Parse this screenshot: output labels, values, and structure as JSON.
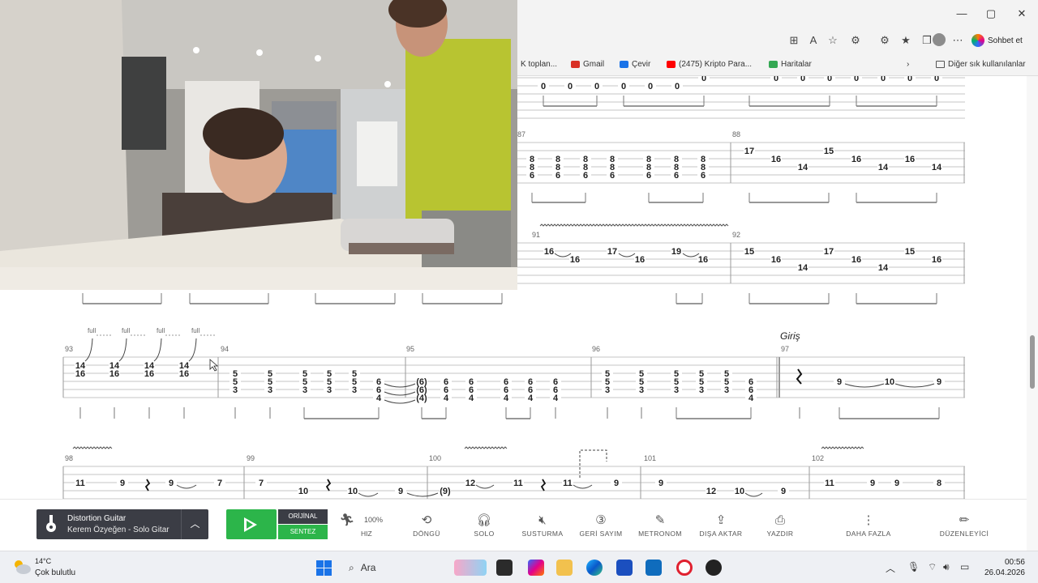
{
  "browser": {
    "window_controls": {
      "minimize": "—",
      "maximize": "▢",
      "close": "✕"
    },
    "chat_button_label": "Sohbet et",
    "bookmarks": [
      {
        "label": "K toplan...",
        "icon": "bookmark-icon",
        "color": "#9a9a9a"
      },
      {
        "label": "Gmail",
        "icon": "gmail-icon",
        "color": "#d93025"
      },
      {
        "label": "Çevir",
        "icon": "translate-icon",
        "color": "#1a73e8"
      },
      {
        "label": "(2475) Kripto Para...",
        "icon": "youtube-icon",
        "color": "#ff0000"
      },
      {
        "label": "Haritalar",
        "icon": "maps-icon",
        "color": "#34a853"
      }
    ],
    "other_bookmarks_label": "Diğer sık kullanılanlar"
  },
  "score": {
    "section_marker": "Giriş",
    "bend_label": "full",
    "measure_numbers": [
      "87",
      "88",
      "91",
      "92",
      "93",
      "94",
      "95",
      "96",
      "97",
      "98",
      "99",
      "100",
      "101",
      "102"
    ],
    "row1_notes": [
      {
        "t": "0",
        "s": 1
      },
      {
        "t": "0",
        "s": 1
      },
      {
        "t": "0",
        "s": 1
      },
      {
        "t": "0",
        "s": 1
      },
      {
        "t": "0",
        "s": 1
      },
      {
        "t": "0",
        "s": 1
      },
      {
        "t": "0",
        "s": 2
      },
      {
        "t": "0",
        "s": 2
      },
      {
        "t": "0",
        "s": 2
      },
      {
        "t": "0",
        "s": 2
      },
      {
        "t": "0",
        "s": 2
      },
      {
        "t": "0",
        "s": 2
      },
      {
        "t": "0",
        "s": 2
      },
      {
        "t": "0",
        "s": 2
      }
    ],
    "m87_chord": [
      "8",
      "8",
      "6"
    ],
    "m88_notes": [
      "17",
      "16",
      "14",
      "15",
      "16",
      "14",
      "16",
      "14"
    ],
    "m91_notes": [
      "16",
      "16",
      "17",
      "16",
      "19",
      "16"
    ],
    "m92_notes": [
      "15",
      "16",
      "14",
      "17",
      "16",
      "14",
      "15",
      "16"
    ],
    "m93_notes": [
      "14",
      "16"
    ],
    "m94_chord": [
      "5",
      "5",
      "3"
    ],
    "m95_chord": [
      "6",
      "6",
      "4"
    ],
    "m95_tied": [
      "(6)",
      "(6)",
      "(4)"
    ],
    "m97_notes": [
      "9",
      "10",
      "9"
    ],
    "m98_notes": [
      "11",
      "9",
      "9",
      "7"
    ],
    "m99_notes": [
      "7",
      "10",
      "10",
      "9",
      "(9)"
    ],
    "m100_notes": [
      "12",
      "11",
      "11",
      "9"
    ],
    "m101_notes": [
      "9",
      "12",
      "10",
      "9"
    ],
    "m102_notes": [
      "11",
      "9",
      "9",
      "8"
    ]
  },
  "toolbar": {
    "instrument_name": "Distortion Guitar",
    "instrument_track": "Kerem Özyeğen - Solo Gitar",
    "mode_original": "ORİJİNAL",
    "mode_synth": "SENTEZ",
    "speed_value": "100%",
    "items": [
      {
        "label": "HIZ",
        "icon": "speed-icon"
      },
      {
        "label": "DÖNGÜ",
        "icon": "loop-icon"
      },
      {
        "label": "SOLO",
        "icon": "headphones-icon"
      },
      {
        "label": "SUSTURMA",
        "icon": "mute-icon"
      },
      {
        "label": "GERİ SAYIM",
        "icon": "countdown-icon"
      },
      {
        "label": "METRONOM",
        "icon": "metronome-icon"
      },
      {
        "label": "DIŞA AKTAR",
        "icon": "export-icon"
      },
      {
        "label": "YAZDIR",
        "icon": "print-icon"
      },
      {
        "label": "DAHA FAZLA",
        "icon": "more-icon"
      },
      {
        "label": "DÜZENLEYİCİ",
        "icon": "editor-icon"
      }
    ]
  },
  "taskbar": {
    "temperature": "14°C",
    "weather": "Çok bulutlu",
    "search_label": "Ara",
    "time": "00:56",
    "date": "26.04.2026"
  },
  "colors": {
    "accent_green": "#2cb54a",
    "dark_panel": "#3b3d45"
  }
}
